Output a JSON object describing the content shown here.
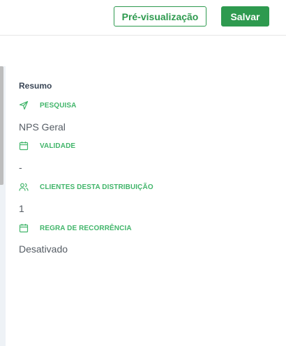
{
  "header": {
    "preview_label": "Pré-visualização",
    "save_label": "Salvar"
  },
  "summary": {
    "title": "Resumo",
    "sections": [
      {
        "icon": "send-icon",
        "label": "PESQUISA",
        "value": "NPS Geral"
      },
      {
        "icon": "calendar-icon",
        "label": "VALIDADE",
        "value": "-"
      },
      {
        "icon": "users-icon",
        "label": "CLIENTES DESTA DISTRIBUIÇÃO",
        "value": "1"
      },
      {
        "icon": "calendar-icon",
        "label": "REGRA DE RECORRÊNCIA",
        "value": "Desativado"
      }
    ]
  },
  "colors": {
    "accent": "#2e9a4f",
    "label_green": "#41b56a"
  }
}
